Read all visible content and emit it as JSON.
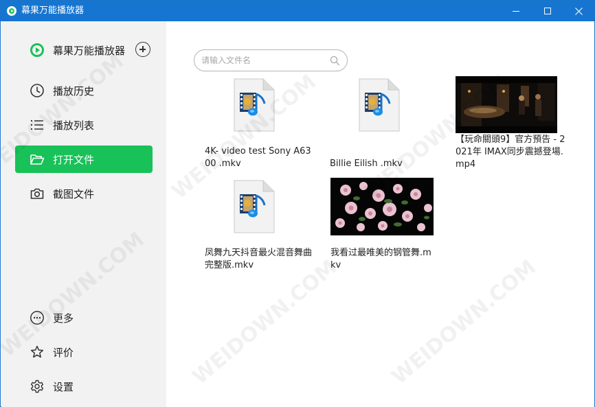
{
  "window": {
    "title": "幕果万能播放器",
    "controls": {
      "minimize": "minimize",
      "maximize": "maximize",
      "close": "close"
    }
  },
  "sidebar": {
    "brand_label": "幕果万能播放器",
    "add_icon": "plus-circle-icon",
    "items": [
      {
        "label": "播放历史",
        "icon": "clock-icon",
        "active": false
      },
      {
        "label": "播放列表",
        "icon": "list-icon",
        "active": false
      },
      {
        "label": "打开文件",
        "icon": "folder-open-icon",
        "active": true
      },
      {
        "label": "截图文件",
        "icon": "camera-icon",
        "active": false
      }
    ],
    "bottom_items": [
      {
        "label": "更多",
        "icon": "more-icon"
      },
      {
        "label": "评价",
        "icon": "star-icon"
      },
      {
        "label": "设置",
        "icon": "gear-icon"
      }
    ]
  },
  "search": {
    "placeholder": "请输入文件名",
    "value": ""
  },
  "files": [
    {
      "name": "4K- video test Sony A6300 .mkv",
      "thumbnail": "media-file-icon"
    },
    {
      "name": "Billie Eilish .mkv",
      "thumbnail": "media-file-icon"
    },
    {
      "name": "【玩命關頭9】官方預告 - 2021年 IMAX同步震撼登場.mp4",
      "thumbnail": "movie-frame-thumbnail"
    },
    {
      "name": "凤舞九天抖音最火混音舞曲完整版.mkv",
      "thumbnail": "media-file-icon"
    },
    {
      "name": "我看过最唯美的钢管舞.mkv",
      "thumbnail": "flowers-frame-thumbnail"
    }
  ],
  "watermark": "WEIDOWN.COM",
  "colors": {
    "titlebar": "#1675d1",
    "accent": "#19c159",
    "sidebar_bg": "#f2f2f2"
  }
}
